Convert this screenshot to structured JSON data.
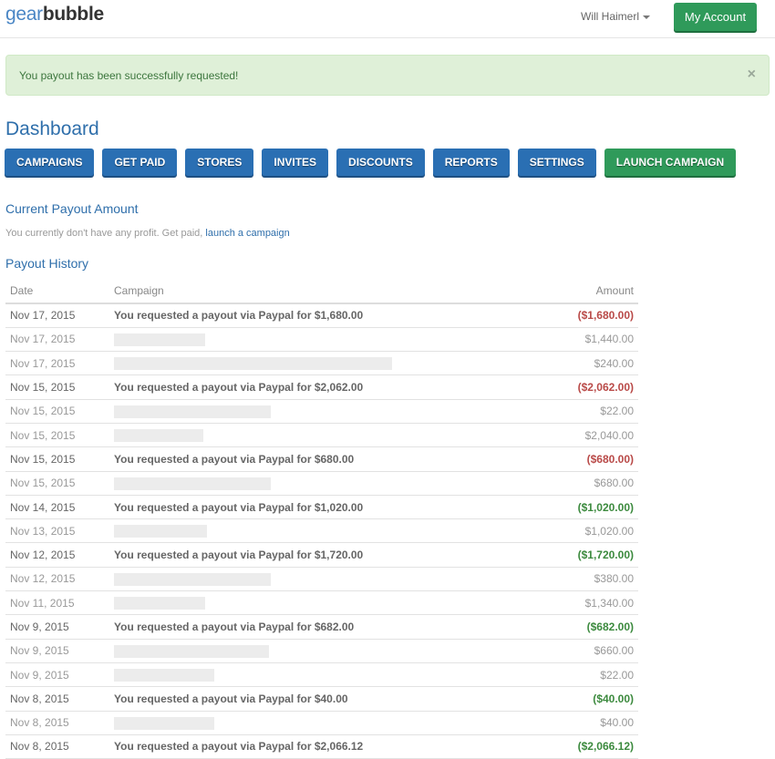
{
  "header": {
    "logo_part1": "gear",
    "logo_part2": "bubble",
    "user_name": "Will Haimerl",
    "my_account_label": "My Account"
  },
  "alert": {
    "message": "You payout has been successfully requested!",
    "close_icon": "×"
  },
  "page_title": "Dashboard",
  "nav": [
    {
      "label": "CAMPAIGNS",
      "style": "blue"
    },
    {
      "label": "GET PAID",
      "style": "blue"
    },
    {
      "label": "STORES",
      "style": "blue"
    },
    {
      "label": "INVITES",
      "style": "blue"
    },
    {
      "label": "DISCOUNTS",
      "style": "blue"
    },
    {
      "label": "REPORTS",
      "style": "blue"
    },
    {
      "label": "SETTINGS",
      "style": "blue"
    },
    {
      "label": "LAUNCH CAMPAIGN",
      "style": "green"
    }
  ],
  "current_payout": {
    "title": "Current Payout Amount",
    "text": "You currently don't have any profit. Get paid, ",
    "link": "launch a campaign"
  },
  "payout_history": {
    "title": "Payout History",
    "columns": [
      "Date",
      "Campaign",
      "Amount"
    ],
    "rows": [
      {
        "date": "Nov 17, 2015",
        "campaign": "You requested a payout via Paypal for $1,680.00",
        "amount": "($1,680.00)",
        "type": "neg"
      },
      {
        "date": "Nov 17, 2015",
        "campaign": "",
        "redacted": true,
        "amount": "$1,440.00",
        "type": "item"
      },
      {
        "date": "Nov 17, 2015",
        "campaign": "",
        "redacted": true,
        "amount": "$240.00",
        "type": "item"
      },
      {
        "date": "Nov 15, 2015",
        "campaign": "You requested a payout via Paypal for $2,062.00",
        "amount": "($2,062.00)",
        "type": "neg"
      },
      {
        "date": "Nov 15, 2015",
        "campaign": "",
        "redacted": true,
        "amount": "$22.00",
        "type": "item"
      },
      {
        "date": "Nov 15, 2015",
        "campaign": "",
        "redacted": true,
        "amount": "$2,040.00",
        "type": "item"
      },
      {
        "date": "Nov 15, 2015",
        "campaign": "You requested a payout via Paypal for $680.00",
        "amount": "($680.00)",
        "type": "neg"
      },
      {
        "date": "Nov 15, 2015",
        "campaign": "",
        "redacted": true,
        "amount": "$680.00",
        "type": "item"
      },
      {
        "date": "Nov 14, 2015",
        "campaign": "You requested a payout via Paypal for $1,020.00",
        "amount": "($1,020.00)",
        "type": "pos"
      },
      {
        "date": "Nov 13, 2015",
        "campaign": "",
        "redacted": true,
        "amount": "$1,020.00",
        "type": "item"
      },
      {
        "date": "Nov 12, 2015",
        "campaign": "You requested a payout via Paypal for $1,720.00",
        "amount": "($1,720.00)",
        "type": "pos"
      },
      {
        "date": "Nov 12, 2015",
        "campaign": "",
        "redacted": true,
        "amount": "$380.00",
        "type": "item"
      },
      {
        "date": "Nov 11, 2015",
        "campaign": "",
        "redacted": true,
        "amount": "$1,340.00",
        "type": "item"
      },
      {
        "date": "Nov 9, 2015",
        "campaign": "You requested a payout via Paypal for $682.00",
        "amount": "($682.00)",
        "type": "pos"
      },
      {
        "date": "Nov 9, 2015",
        "campaign": "",
        "redacted": true,
        "amount": "$660.00",
        "type": "item"
      },
      {
        "date": "Nov 9, 2015",
        "campaign": "",
        "redacted": true,
        "amount": "$22.00",
        "type": "item"
      },
      {
        "date": "Nov 8, 2015",
        "campaign": "You requested a payout via Paypal for $40.00",
        "amount": "($40.00)",
        "type": "pos"
      },
      {
        "date": "Nov 8, 2015",
        "campaign": "",
        "redacted": true,
        "amount": "$40.00",
        "type": "item"
      },
      {
        "date": "Nov 8, 2015",
        "campaign": "You requested a payout via Paypal for $2,066.12",
        "amount": "($2,066.12)",
        "type": "pos"
      }
    ]
  },
  "colors": {
    "brand_blue": "#2a6fb3",
    "brand_green": "#2f9a5a",
    "negative_amount": "#b94a48",
    "positive_amount": "#3c8a3e",
    "alert_bg": "#dff0d8"
  }
}
